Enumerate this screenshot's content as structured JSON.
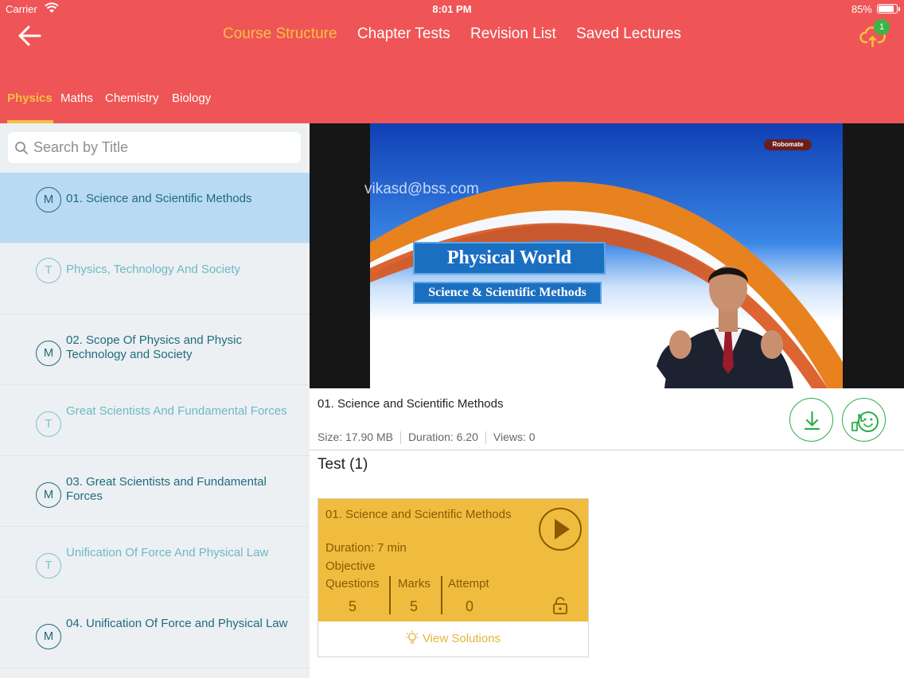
{
  "status_bar": {
    "carrier": "Carrier",
    "time": "8:01 PM",
    "battery": "85%",
    "battery_level": 0.85
  },
  "top_nav": {
    "items": [
      "Course Structure",
      "Chapter Tests",
      "Revision List",
      "Saved Lectures"
    ],
    "active": "Course Structure"
  },
  "upload": {
    "badge": "1"
  },
  "subjects": {
    "tabs": [
      "Physics",
      "Maths",
      "Chemistry",
      "Biology"
    ],
    "active": "Physics"
  },
  "search": {
    "placeholder": "Search by Title",
    "value": ""
  },
  "chapters": [
    {
      "badge": "M",
      "title": "01. Science and Scientific Methods",
      "type": "module",
      "selected": true
    },
    {
      "badge": "T",
      "title": "Physics, Technology And Society",
      "type": "test",
      "selected": false
    },
    {
      "badge": "M",
      "title": "02. Scope Of Physics and Physic Technology and Society",
      "type": "module",
      "selected": false
    },
    {
      "badge": "T",
      "title": "Great Scientists And Fundamental Forces",
      "type": "test",
      "selected": false
    },
    {
      "badge": "M",
      "title": "03. Great Scientists and Fundamental Forces",
      "type": "module",
      "selected": false
    },
    {
      "badge": "T",
      "title": "Unification Of Force And Physical Law",
      "type": "test",
      "selected": false
    },
    {
      "badge": "M",
      "title": "04. Unification Of Force and Physical Law",
      "type": "module",
      "selected": false
    }
  ],
  "video": {
    "watermark": "vikasd@bss.com",
    "logo": "Robomate",
    "slide_title": "Physical World",
    "slide_subtitle": "Science & Scientific Methods"
  },
  "lecture": {
    "title": "01. Science and Scientific Methods",
    "size": "Size: 17.90 MB",
    "duration": "Duration: 6.20",
    "views": "Views: 0"
  },
  "tests": {
    "heading": "Test (1)",
    "card": {
      "title": "01. Science and Scientific Methods",
      "duration": "Duration:  7 min",
      "type": "Objective",
      "questions_label": "Questions",
      "questions": "5",
      "marks_label": "Marks",
      "marks": "5",
      "attempt_label": "Attempt",
      "attempt": "0",
      "solutions_label": "View Solutions"
    }
  },
  "colors": {
    "header": "#ef5556",
    "accent": "#f6c042",
    "sidebar": "#ecf0f3",
    "selected": "#b9daf3",
    "teal": "#1f6b7d",
    "green": "#2cad4a",
    "card": "#f0bc3f"
  }
}
